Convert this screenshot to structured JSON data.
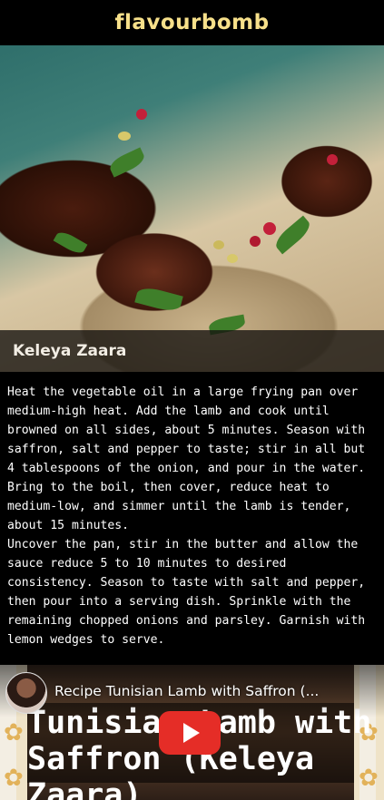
{
  "header": {
    "brand": "flavourbomb"
  },
  "hero": {
    "title": "Keleya Zaara"
  },
  "recipe": {
    "paragraphs": [
      "Heat the vegetable oil in a large frying pan over medium-high heat. Add the lamb and cook until browned on all sides, about 5 minutes. Season with saffron, salt and pepper to taste; stir in all but 4 tablespoons of the onion, and pour in the water. Bring to the boil, then cover, reduce heat to medium-low, and simmer until the lamb is tender, about 15 minutes.",
      "Uncover the pan, stir in the butter and allow the sauce reduce 5 to 10 minutes to desired consistency. Season to taste with salt and pepper, then pour into a serving dish. Sprinkle with the remaining chopped onions and parsley. Garnish with lemon wedges to serve."
    ]
  },
  "video": {
    "title": "Recipe Tunisian Lamb with Saffron (...",
    "thumbnail_text": "Tunisian Lamb with\nSaffron (Keleya\nZaara)",
    "play_icon": "youtube-play-icon"
  },
  "colors": {
    "brand": "#f7e08a",
    "background": "#000000",
    "play_button": "#e52d27"
  }
}
